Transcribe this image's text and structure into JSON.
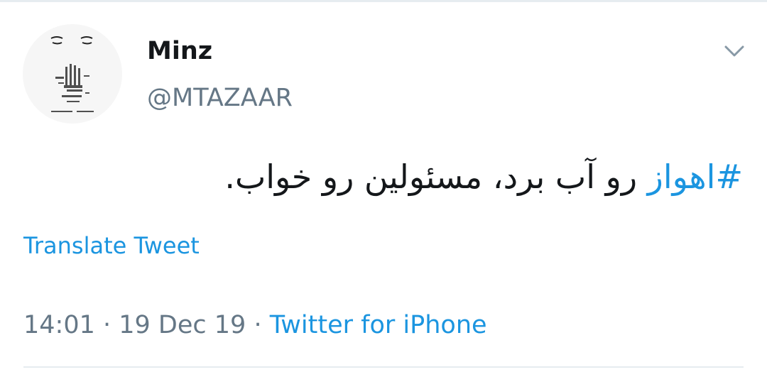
{
  "tweet": {
    "display_name": "Minz",
    "handle": "@MTAZAAR",
    "hashtag": "#اهواز",
    "text_rest": " رو آب برد، مسئولین رو خواب.",
    "translate_label": "Translate Tweet",
    "time": "14:01",
    "separator": " · ",
    "date": "19 Dec 19",
    "source": "Twitter for iPhone"
  },
  "icons": {
    "caret": "chevron-down-icon",
    "avatar": "avatar-sketch"
  },
  "colors": {
    "link_blue": "#1b95e0",
    "text_primary": "#14171a",
    "text_secondary": "#657786",
    "divider": "#e6ecf0"
  }
}
